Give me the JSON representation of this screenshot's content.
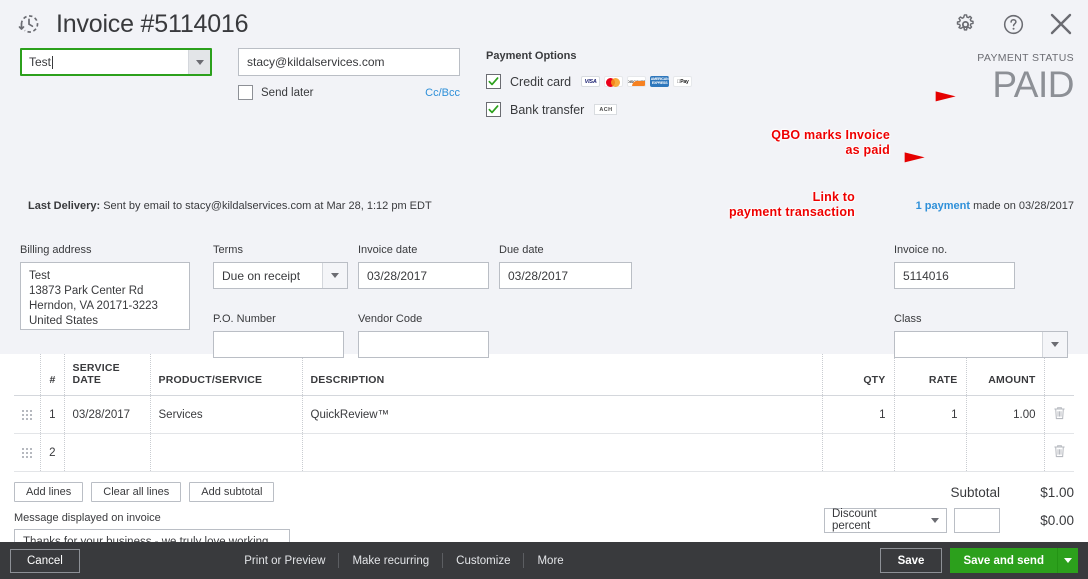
{
  "header": {
    "title": "Invoice #5114016",
    "history_icon": "history-clock-icon",
    "gear_icon": "gear-icon",
    "help_icon": "help-icon",
    "close_icon": "close-icon"
  },
  "customer": {
    "value": "Test",
    "dropdown_icon": "chevron-down-icon"
  },
  "email": {
    "value": "stacy@kildalservices.com",
    "send_later_label": "Send later",
    "send_later_checked": false,
    "ccbcc_label": "Cc/Bcc"
  },
  "payment_options": {
    "title": "Payment Options",
    "credit_card": {
      "label": "Credit card",
      "checked": true,
      "logos": [
        "VISA",
        "mastercard-icon",
        "DISCOVER",
        "AMERICAN EXPRESS",
        "Apple Pay"
      ]
    },
    "bank_transfer": {
      "label": "Bank transfer",
      "checked": true,
      "badge": "ACH"
    }
  },
  "payment_status": {
    "label": "PAYMENT STATUS",
    "value": "PAID",
    "link_text": "1 payment",
    "link_suffix": " made on 03/28/2017",
    "link_color": "#2f90d9"
  },
  "last_delivery": {
    "prefix": "Last Delivery:",
    "text": " Sent by email to stacy@kildalservices.com at Mar 28, 1:12 pm EDT"
  },
  "fields": {
    "billing_address_label": "Billing address",
    "billing_address_value": "Test\n13873 Park Center Rd\nHerndon, VA  20171-3223\nUnited States",
    "terms_label": "Terms",
    "terms_value": "Due on receipt",
    "invoice_date_label": "Invoice date",
    "invoice_date_value": "03/28/2017",
    "due_date_label": "Due date",
    "due_date_value": "03/28/2017",
    "po_number_label": "P.O. Number",
    "po_number_value": "",
    "vendor_code_label": "Vendor Code",
    "vendor_code_value": "",
    "invoice_no_label": "Invoice no.",
    "invoice_no_value": "5114016",
    "class_label": "Class",
    "class_value": ""
  },
  "table": {
    "columns": [
      "#",
      "SERVICE DATE",
      "PRODUCT/SERVICE",
      "DESCRIPTION",
      "QTY",
      "RATE",
      "AMOUNT"
    ],
    "rows": [
      {
        "num": "1",
        "service_date": "03/28/2017",
        "product": "Services",
        "description": "QuickReview™",
        "qty": "1",
        "rate": "1",
        "amount": "1.00"
      },
      {
        "num": "2",
        "service_date": "",
        "product": "",
        "description": "",
        "qty": "",
        "rate": "",
        "amount": ""
      }
    ],
    "trash_icon": "trash-icon",
    "drag_icon": "drag-handle-icon"
  },
  "actions": {
    "add_lines": "Add lines",
    "clear_all_lines": "Clear all lines",
    "add_subtotal": "Add subtotal"
  },
  "message": {
    "label": "Message displayed on invoice",
    "value": "Thanks for your business - we truly love working with"
  },
  "totals": {
    "subtotal_label": "Subtotal",
    "subtotal_value": "$1.00",
    "discount_label": "Discount percent",
    "discount_input_value": "",
    "discount_value": "$0.00"
  },
  "footer": {
    "cancel": "Cancel",
    "links": [
      "Print or Preview",
      "Make recurring",
      "Customize",
      "More"
    ],
    "save": "Save",
    "save_and_send": "Save and send",
    "save_dropdown_icon": "chevron-down-icon",
    "accent_color": "#2ca01c"
  },
  "annotations": [
    {
      "text": "QBO marks Invoice\nas paid",
      "color": "#ee0000"
    },
    {
      "text": "Link to\npayment transaction",
      "color": "#ee0000"
    }
  ]
}
